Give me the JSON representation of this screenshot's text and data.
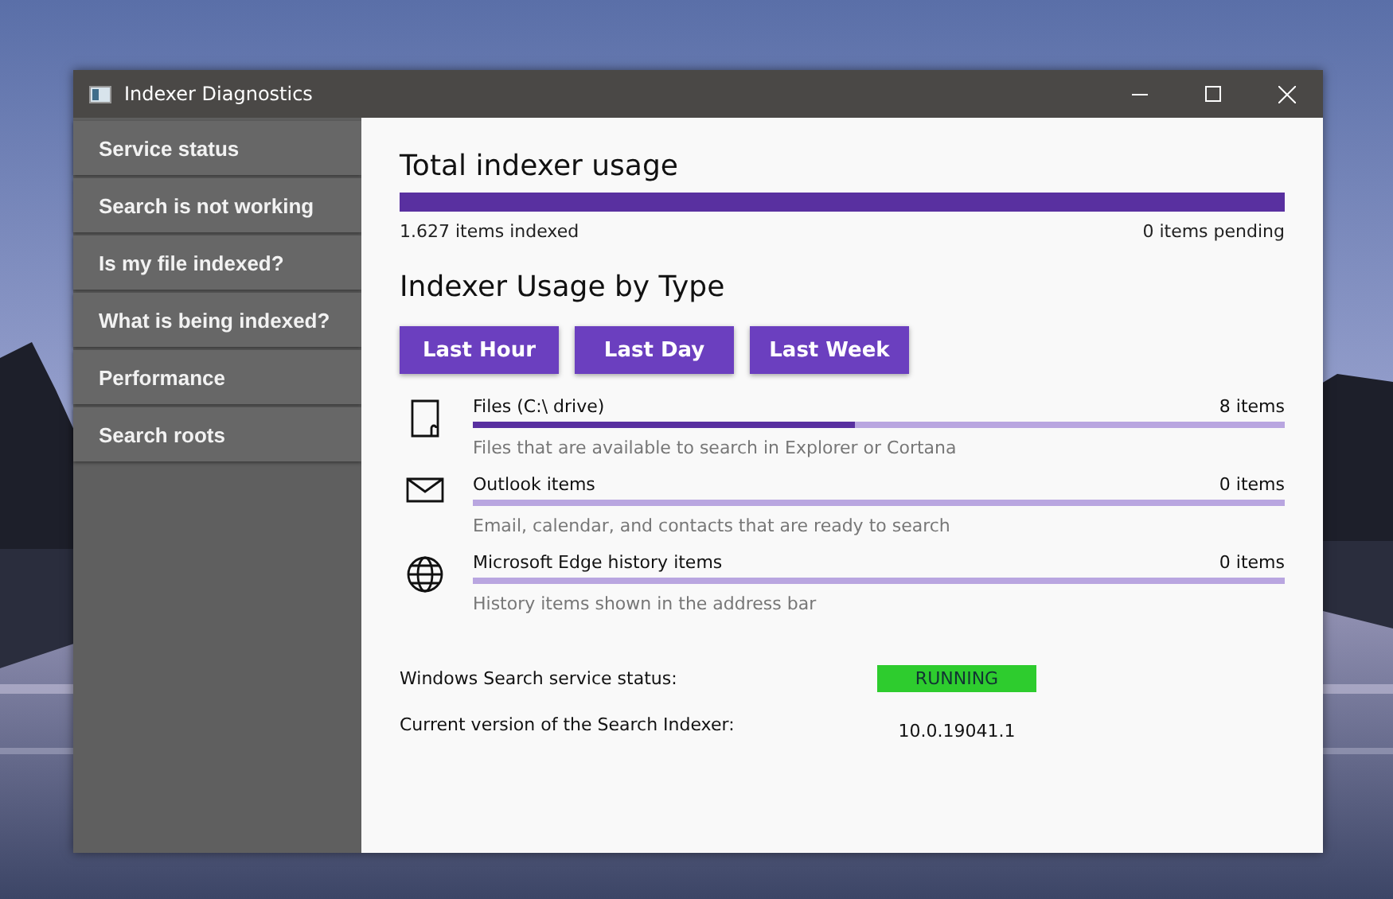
{
  "window": {
    "title": "Indexer Diagnostics"
  },
  "sidebar": {
    "items": [
      {
        "label": "Service status"
      },
      {
        "label": "Search is not working"
      },
      {
        "label": "Is my file indexed?"
      },
      {
        "label": "What is being indexed?"
      },
      {
        "label": "Performance"
      },
      {
        "label": "Search roots"
      }
    ]
  },
  "total": {
    "title": "Total indexer usage",
    "level": 1,
    "indexed": "1.627 items indexed",
    "pending": "0 items pending"
  },
  "by_type": {
    "title": "Indexer Usage by Type",
    "buttons": [
      "Last Hour",
      "Last Day",
      "Last Week"
    ],
    "items": [
      {
        "kind": "file",
        "name": "Files (C:\\ drive)",
        "count": "8 items",
        "level": 0.47,
        "description": "Files that are available to search in Explorer or Cortana"
      },
      {
        "kind": "mail",
        "name": "Outlook items",
        "count": "0 items",
        "level": 0,
        "description": "Email, calendar, and contacts that are ready to search"
      },
      {
        "kind": "web",
        "name": "Microsoft Edge history items",
        "count": "0 items",
        "level": 0,
        "description": "History items shown in the address bar"
      }
    ]
  },
  "status": {
    "service_label": "Windows Search service status:",
    "service_value": "RUNNING",
    "version_label": "Current version of the Search Indexer:",
    "version_value": "10.0.19041.1"
  }
}
